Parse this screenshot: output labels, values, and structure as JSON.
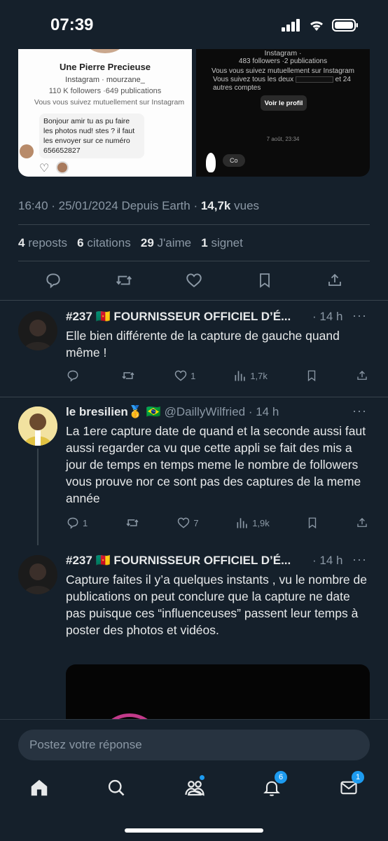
{
  "status_bar": {
    "time": "07:39"
  },
  "media": {
    "left": {
      "name": "Une Pierre Precieuse",
      "handle": "Instagram · mourzane_",
      "stats": "110 K followers ·649 publications",
      "mutual": "Vous vous suivez mutuellement sur Instagram",
      "message": "Bonjour amir tu as pu faire les photos nud! stes ? il faut les envoyer sur ce numéro 656652827"
    },
    "right": {
      "handle": "Instagram ·",
      "stats": "483 followers ·2 publications",
      "mutual": "Vous vous suivez mutuellement sur Instagram",
      "both_prefix": "Vous suivez tous les deux",
      "both_suffix": "et 24 autres comptes",
      "button": "Voir le profil",
      "date": "7 août, 23:34",
      "bubble": "Co"
    }
  },
  "tweet": {
    "meta_prefix": "16:40 · 25/01/2024 Depuis Earth · ",
    "views_count": "14,7k",
    "views_label": " vues",
    "reposts_count": "4",
    "reposts_label": "reposts",
    "quotes_count": "6",
    "quotes_label": "citations",
    "likes_count": "29",
    "likes_label": "J'aime",
    "bookmarks_count": "1",
    "bookmarks_label": "signet"
  },
  "replies": [
    {
      "name": "#237 🇨🇲 FOURNISSEUR OFFICIEL D’É...",
      "handle": "",
      "time": "· 14 h",
      "text": "Elle bien différente de la capture de gauche quand même !",
      "replies": "",
      "likes": "1",
      "views": "1,7k"
    },
    {
      "name": "le bresilien🥇 🇧🇷",
      "handle": " @DaillyWilfried",
      "time": "· 14 h",
      "text": "La 1ere capture date de quand et la seconde aussi faut aussi regarder ca vu que cette appli se fait des mis a jour de temps en temps meme le nombre de followers vous prouve nor ce sont pas des captures de la meme année",
      "replies": "1",
      "likes": "7",
      "views": "1,9k"
    },
    {
      "name": "#237 🇨🇲 FOURNISSEUR OFFICIEL D’É...",
      "handle": "",
      "time": "· 14 h",
      "text": "Capture faites il y’a quelques instants , vu le nombre de publications on peut conclure que la capture ne date pas puisque ces “influenceuses” passent leur temps à poster des photos et vidéos."
    }
  ],
  "compose": {
    "placeholder": "Postez votre réponse"
  },
  "tabbar": {
    "notifications_badge": "6",
    "messages_badge": "1"
  },
  "colors": {
    "background": "#15202b",
    "accent": "#1d9bf0",
    "muted": "#8b98a5"
  }
}
